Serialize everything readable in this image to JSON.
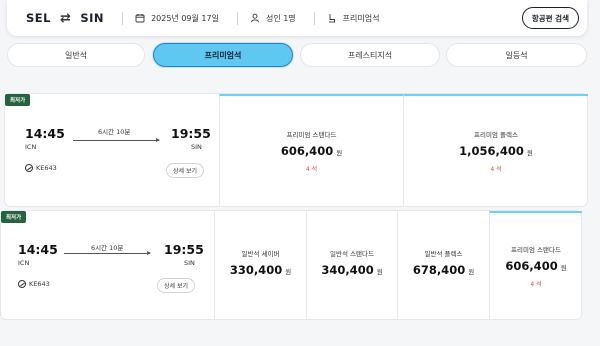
{
  "search": {
    "origin": "SEL",
    "destination": "SIN",
    "date": "2025년 09월 17일",
    "passengers": "성인 1명",
    "cabin": "프리미엄석",
    "search_button": "항공편 검색"
  },
  "tabs": [
    {
      "label": "일반석",
      "active": false
    },
    {
      "label": "프리미엄석",
      "active": true
    },
    {
      "label": "프레스티지석",
      "active": false
    },
    {
      "label": "일등석",
      "active": false
    }
  ],
  "results": [
    {
      "badge": "최저가",
      "depart_time": "14:45",
      "depart_airport": "ICN",
      "arrive_time": "19:55",
      "arrive_airport": "SIN",
      "duration": "6시간 10분",
      "flight_no": "KE643",
      "detail_label": "상세 보기",
      "fares": [
        {
          "name": "프리미엄 스탠다드",
          "price": "606,400",
          "currency": "원",
          "seats": "4 석"
        },
        {
          "name": "프리미엄 플렉스",
          "price": "1,056,400",
          "currency": "원",
          "seats": "4 석"
        }
      ]
    },
    {
      "badge": "최저가",
      "depart_time": "14:45",
      "depart_airport": "ICN",
      "arrive_time": "19:55",
      "arrive_airport": "SIN",
      "duration": "6시간 10분",
      "flight_no": "KE643",
      "detail_label": "상세 보기",
      "fares": [
        {
          "name": "일반석 세이버",
          "price": "330,400",
          "currency": "원",
          "seats": ""
        },
        {
          "name": "일반석 스탠다드",
          "price": "340,400",
          "currency": "원",
          "seats": ""
        },
        {
          "name": "일반석 플렉스",
          "price": "678,400",
          "currency": "원",
          "seats": ""
        },
        {
          "name": "프리미엄 스탠다드",
          "price": "606,400",
          "currency": "원",
          "seats": "4 석"
        }
      ]
    }
  ],
  "colors": {
    "accent": "#5fc8f1",
    "badge": "#27623f",
    "seats": "#e04545"
  }
}
